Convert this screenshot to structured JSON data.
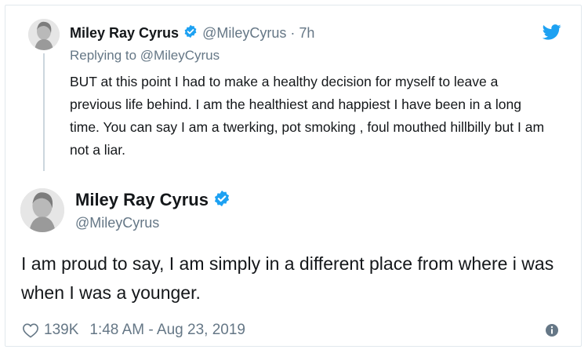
{
  "colors": {
    "verified_blue": "#1da1f2",
    "secondary_text": "#657786",
    "primary_text": "#14171a",
    "thread_line": "#ccd6dd"
  },
  "reply": {
    "author_name": "Miley Ray Cyrus",
    "handle": "@MileyCyrus",
    "separator": "·",
    "time": "7h",
    "replying_to_label": "Replying to",
    "replying_to_handle": "@MileyCyrus",
    "text": "BUT at this point I had to make a healthy decision for myself to leave a previous life behind. I am the healthiest and happiest I have been in a long time.  You can say I am a twerking, pot smoking , foul mouthed hillbilly but I am not a liar.",
    "icons": [
      "verified-badge-icon",
      "twitter-bird-icon"
    ]
  },
  "tweet": {
    "author_name": "Miley Ray Cyrus",
    "handle": "@MileyCyrus",
    "text": "I am proud to say, I am simply in a different place from where i was when I was a younger.",
    "like_count": "139K",
    "timestamp": "1:48 AM - Aug 23, 2019",
    "icons": [
      "verified-badge-icon",
      "heart-icon",
      "info-icon"
    ]
  }
}
